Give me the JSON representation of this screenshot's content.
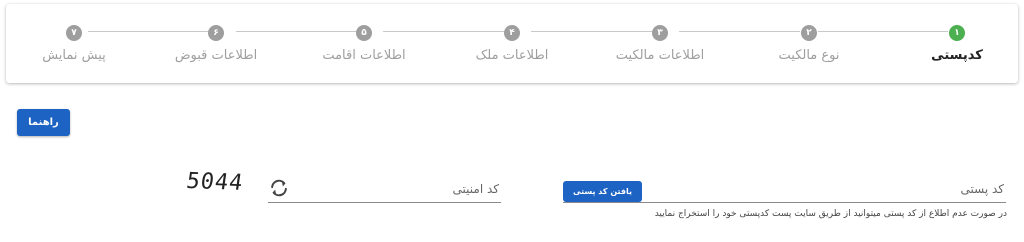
{
  "stepper": {
    "steps": [
      {
        "number": "۱",
        "label": "کدپستی",
        "active": true
      },
      {
        "number": "۲",
        "label": "نوع مالکیت",
        "active": false
      },
      {
        "number": "۳",
        "label": "اطلاعات مالکیت",
        "active": false
      },
      {
        "number": "۴",
        "label": "اطلاعات ملک",
        "active": false
      },
      {
        "number": "۵",
        "label": "اطلاعات اقامت",
        "active": false
      },
      {
        "number": "۶",
        "label": "اطلاعات قبوض",
        "active": false
      },
      {
        "number": "۷",
        "label": "پیش نمایش",
        "active": false
      }
    ],
    "colors": {
      "active": "#4caf50",
      "inactive": "#9e9e9e"
    }
  },
  "help_button": {
    "label": "راهنما"
  },
  "postal_code": {
    "placeholder": "کد پستی",
    "find_button_label": "یافتن کد پستی",
    "hint": "در صورت عدم اطلاع از کد پستی میتوانید از طریق سایت پست کدپستی خود را استخراج نمایید"
  },
  "captcha": {
    "placeholder": "کد امنیتی",
    "code": "5044",
    "refresh_icon": "refresh-icon"
  },
  "accent_color": "#1d63c4"
}
